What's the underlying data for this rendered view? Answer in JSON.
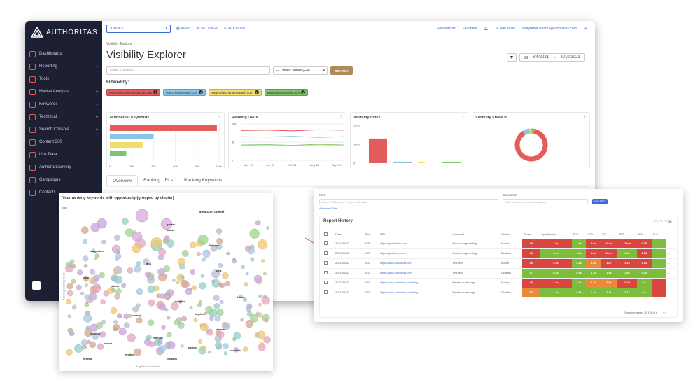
{
  "app": {
    "logo_text": "AUTHORITAS"
  },
  "sidebar": {
    "items": [
      {
        "label": "Dashboards",
        "icon": "dashboard-icon",
        "chev": false
      },
      {
        "label": "Reporting",
        "icon": "reporting-icon",
        "chev": true
      },
      {
        "label": "Tools",
        "icon": "tools-icon",
        "chev": false
      },
      {
        "label": "Market Analysis",
        "icon": "market-icon",
        "chev": true
      },
      {
        "label": "Keywords",
        "icon": "keywords-icon",
        "chev": true
      },
      {
        "label": "Technical",
        "icon": "technical-icon",
        "chev": true
      },
      {
        "label": "Search Console",
        "icon": "search-console-icon",
        "chev": true
      },
      {
        "label": "Content 360",
        "icon": "content-icon",
        "chev": false
      },
      {
        "label": "Link Data",
        "icon": "link-icon",
        "chev": false
      },
      {
        "label": "Author Discovery",
        "icon": "author-icon",
        "chev": false
      },
      {
        "label": "Campaigns",
        "icon": "campaigns-icon",
        "chev": false
      },
      {
        "label": "Contacts",
        "icon": "contacts-icon",
        "chev": false
      }
    ]
  },
  "topbar": {
    "select_value": "*UNDEX",
    "links": [
      "APPS",
      "SETTINGS",
      "ACCOUNT"
    ],
    "right_links": [
      "Precedents",
      "Favorites"
    ],
    "add_label": "Add Team",
    "user": "lauryrame.stanbul@authoritas.com"
  },
  "page": {
    "breadcrumb": "Visibility Explorer",
    "title": "Visibility Explorer",
    "date_from": "6/4/2021",
    "date_sep": "→",
    "date_to": "9/10/2021"
  },
  "search": {
    "placeholder": "Enter a domain",
    "country": "United States (EN)",
    "button": "SEARCH"
  },
  "filter": {
    "label": "Filtered by:",
    "chips": [
      {
        "text": "www.searchenginejournal.com",
        "color": "#e35b5b"
      },
      {
        "text": "searchengineland.com",
        "color": "#8ac4e8"
      },
      {
        "text": "www.searchenginewatch.com",
        "color": "#f4dc6a"
      },
      {
        "text": "www.seroundtable.com",
        "color": "#7dc46b"
      }
    ]
  },
  "cards": [
    {
      "title": "Number Of Keywords"
    },
    {
      "title": "Ranking URLs"
    },
    {
      "title": "Visibility Index"
    },
    {
      "title": "Visibility Share %"
    }
  ],
  "chart_data": [
    {
      "type": "bar",
      "title": "Number Of Keywords",
      "orientation": "horizontal",
      "series": [
        {
          "color": "#e35b5b",
          "value": 98
        },
        {
          "color": "#8ac4e8",
          "value": 40
        },
        {
          "color": "#f4dc6a",
          "value": 30
        },
        {
          "color": "#7dc46b",
          "value": 15
        }
      ],
      "xticks": [
        "0",
        "20k",
        "40k",
        "60k",
        "80k",
        "100k"
      ],
      "xlim": [
        0,
        100
      ]
    },
    {
      "type": "line",
      "title": "Ranking URLs",
      "x": [
        "May '21",
        "Jun '21",
        "Jul '21",
        "Aug '21",
        "Sep '21"
      ],
      "series": [
        {
          "color": "#e35b5b",
          "values": [
            8.2,
            8.3,
            8.1,
            8.4,
            8.3
          ]
        },
        {
          "color": "#8ac4e8",
          "values": [
            6.5,
            6.4,
            6.6,
            6.3,
            6.5
          ]
        },
        {
          "color": "#7dc46b",
          "values": [
            4.2,
            4.3,
            4.1,
            4.4,
            4.2
          ]
        },
        {
          "color": "#f4dc6a",
          "values": [
            4.0,
            4.1,
            4.0,
            4.2,
            4.1
          ]
        }
      ],
      "yticks": [
        "10k",
        "5k",
        "0"
      ],
      "ylim": [
        0,
        10
      ]
    },
    {
      "type": "bar",
      "title": "Visibility Index",
      "series": [
        {
          "color": "#e35b5b",
          "value": 130
        },
        {
          "color": "#8ac4e8",
          "value": 8
        },
        {
          "color": "#f4dc6a",
          "value": 3
        },
        {
          "color": "#7dc46b",
          "value": 3
        }
      ],
      "yticks": [
        "200m",
        "100m",
        "0"
      ],
      "ylim": [
        0,
        200
      ]
    },
    {
      "type": "pie",
      "title": "Visibility Share %",
      "donut": true,
      "values": [
        {
          "color": "#e35b5b",
          "value": 88
        },
        {
          "color": "#8ac4e8",
          "value": 7
        },
        {
          "color": "#f4dc6a",
          "value": 2
        },
        {
          "color": "#7dc46b",
          "value": 3
        }
      ]
    }
  ],
  "tabs": [
    "Overview",
    "Ranking URLs",
    "Ranking Keywords"
  ],
  "bubble": {
    "title": "Your ranking keywords with opportunity (grouped by cluster)",
    "y_top": "high",
    "y_label": "Ranking Visibility Score",
    "x_label": "Avg Search Volume",
    "labels": [
      "www.com tmeasl",
      "gonasi",
      "uzanat",
      "dietosan",
      "mangostore",
      "fanzi",
      "ucha",
      "halan",
      "zatemy",
      "dukka",
      "surfoptes",
      "tanpitee",
      "uzumoji",
      "cleridoro",
      "steuerst",
      "tetanuan",
      "banner",
      "galaton",
      "nasutiwea",
      "wendum",
      "fetosaha",
      "weneka"
    ]
  },
  "report": {
    "url_label": "URL",
    "url_placeholder": "Enter a URL to get a report with them",
    "comment_label": "Comment",
    "comment_placeholder": "Write comments you are tracking",
    "run_label": "RUN TEST",
    "advanced": "Advanced Filter",
    "title": "Report History",
    "columns": [
      "Date",
      "Time",
      "URL",
      "Comment",
      "Device",
      "Score",
      "Speed Index",
      "FCP",
      "LCP",
      "TTI",
      "TBT",
      "FID",
      "CLS"
    ],
    "rows": [
      {
        "date": "2021-09-10",
        "time": "9:05",
        "url": "https://goodurlseo.com",
        "comment": "Product page testing",
        "device": "Mobile",
        "vals": [
          "48",
          "1.8s",
          "1.8s",
          "9.6s",
          "10.6s",
          "114ms",
          "0.05"
        ],
        "cols": [
          "#d9453f",
          "#d9453f",
          "#7cbd3b",
          "#d9453f",
          "#d9453f",
          "#d9453f",
          "#d9453f",
          "#7cbd3b"
        ]
      },
      {
        "date": "2021-09-10",
        "time": "9:05",
        "url": "https://goodurlseo.com",
        "comment": "Product page testing",
        "device": "Desktop",
        "vals": [
          "48",
          "2.1s",
          "1.6s",
          "1.8s",
          "28.0s",
          "2.1s",
          "0.03"
        ],
        "cols": [
          "#d9453f",
          "#7cbd3b",
          "#7cbd3b",
          "#d9453f",
          "#d9453f",
          "#7cbd3b",
          "#d9453f",
          "#7cbd3b"
        ]
      },
      {
        "date": "2021-09-10",
        "time": "9:02",
        "url": "https://www.authoritas.com",
        "comment": "Test test",
        "device": "Mobile",
        "vals": [
          "48",
          "4.4s",
          "3.5s",
          "3.5s",
          "10.7",
          "1.2s",
          "0.04"
        ],
        "cols": [
          "#d9453f",
          "#d9453f",
          "#7cbd3b",
          "#e88a3a",
          "#d9453f",
          "#d9453f",
          "#d9453f",
          "#7cbd3b"
        ]
      },
      {
        "date": "2021-09-10",
        "time": "9:02",
        "url": "https://www.authoritas.com",
        "comment": "Test test",
        "device": "Desktop",
        "vals": [
          "97",
          "0.4s",
          "0.5s",
          "1.1s",
          "1.3s",
          "1.8s",
          "0.03"
        ],
        "cols": [
          "#7cbd3b",
          "#7cbd3b",
          "#7cbd3b",
          "#7cbd3b",
          "#7cbd3b",
          "#7cbd3b",
          "#7cbd3b",
          "#7cbd3b"
        ]
      },
      {
        "date": "2021-09-10",
        "time": "8:59",
        "url": "https://www.authoritas.com/blog",
        "comment": "Retest on test page",
        "device": "Mobile",
        "vals": [
          "48",
          "3.3s",
          "2.2s",
          "4.1s",
          "4.8s",
          "0.48",
          "0.2"
        ],
        "cols": [
          "#d9453f",
          "#d9453f",
          "#7cbd3b",
          "#e88a3a",
          "#e88a3a",
          "#d9453f",
          "#7cbd3b",
          "#d9453f"
        ]
      },
      {
        "date": "2021-09-10",
        "time": "8:59",
        "url": "https://www.authoritas.com/blog",
        "comment": "Retest on test page",
        "device": "Desktop",
        "vals": [
          "80",
          "1.1s",
          "0.8s",
          "1.1s",
          "1.1s",
          "0.14",
          "0.3"
        ],
        "cols": [
          "#e88a3a",
          "#7cbd3b",
          "#7cbd3b",
          "#7cbd3b",
          "#7cbd3b",
          "#7cbd3b",
          "#7cbd3b",
          "#d9453f"
        ]
      }
    ],
    "pager": "Rows per page: 25  1-6 of 6"
  }
}
